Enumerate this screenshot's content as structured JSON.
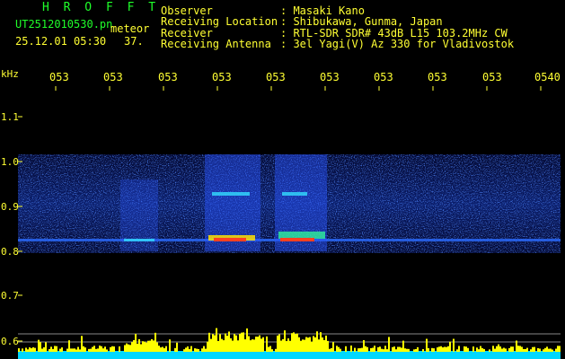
{
  "header": {
    "app_name": "H R O F F T",
    "filename": "UT2512010530.pn",
    "mode_label": "meteor",
    "datetime": "25.12.01 05:30",
    "count": "37."
  },
  "station_info": [
    {
      "label": "Observer",
      "value": ": Masaki Kano"
    },
    {
      "label": "Receiving Location",
      "value": ": Shibukawa, Gunma, Japan"
    },
    {
      "label": "Receiver",
      "value": ": RTL-SDR SDR# 43dB L15 103.2MHz CW"
    },
    {
      "label": "Receiving Antenna",
      "value": ": 3el Yagi(V) Az 330 for Vladivostok"
    }
  ],
  "time_axis": {
    "labels": [
      "053",
      "053",
      "053",
      "053",
      "053",
      "053",
      "053",
      "053",
      "053",
      "0540"
    ]
  },
  "freq_axis": {
    "unit": "kHz",
    "labels": [
      "1.1",
      "1.0",
      "0.9",
      "0.8",
      "0.7",
      "0.6"
    ]
  },
  "colors": {
    "text_yellow": "#ffff33",
    "title_green": "#1fff2a",
    "baseline_cyan": "#00d8ff",
    "activity_yellow": "#ffff00"
  }
}
